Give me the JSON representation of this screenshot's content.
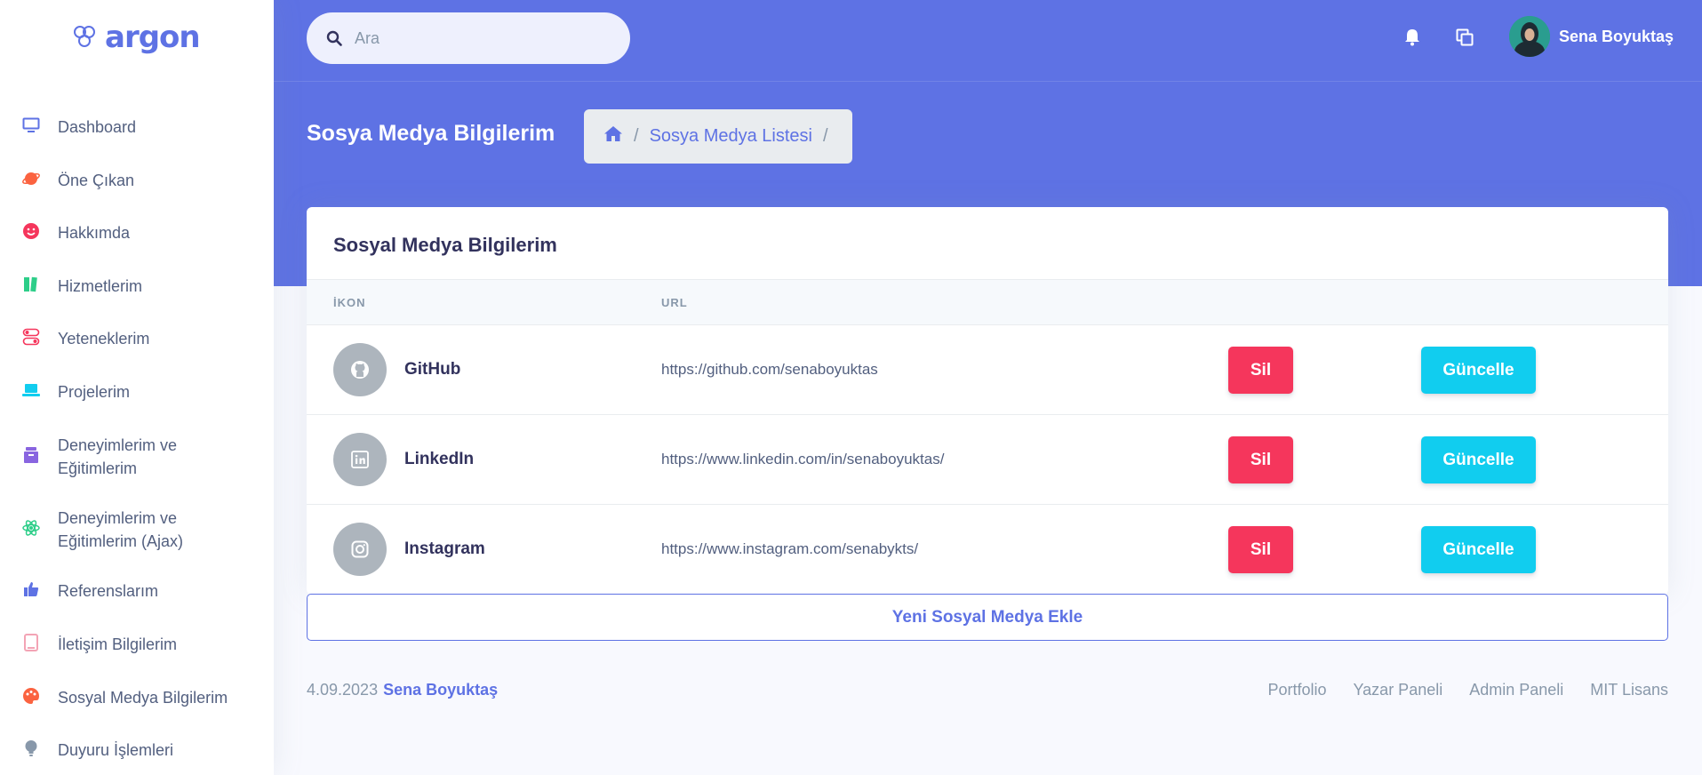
{
  "brand": {
    "name": "argon"
  },
  "sidebar": {
    "items": [
      {
        "label": "Dashboard",
        "icon": "monitor-icon",
        "color": "#5e72e4"
      },
      {
        "label": "Öne Çıkan",
        "icon": "planet-icon",
        "color": "#fb6340"
      },
      {
        "label": "Hakkımda",
        "icon": "smile-icon",
        "color": "#f5365c"
      },
      {
        "label": "Hizmetlerim",
        "icon": "books-icon",
        "color": "#2dce89"
      },
      {
        "label": "Yeteneklerim",
        "icon": "toggles-icon",
        "color": "#f5365c"
      },
      {
        "label": "Projelerim",
        "icon": "laptop-icon",
        "color": "#11cdef"
      },
      {
        "label": "Deneyimlerim ve Eğitimlerim",
        "icon": "archive-icon",
        "color": "#8965e0"
      },
      {
        "label": "Deneyimlerim ve Eğitimlerim (Ajax)",
        "icon": "atom-icon",
        "color": "#2dce89"
      },
      {
        "label": "Referenslarım",
        "icon": "thumbs-up-icon",
        "color": "#5e72e4"
      },
      {
        "label": "İletişim Bilgilerim",
        "icon": "tablet-icon",
        "color": "#f3a4b5"
      },
      {
        "label": "Sosyal Medya Bilgilerim",
        "icon": "palette-icon",
        "color": "#fb6340"
      },
      {
        "label": "Duyuru İşlemleri",
        "icon": "bulb-icon",
        "color": "#8898aa"
      }
    ]
  },
  "search": {
    "placeholder": "Ara"
  },
  "user": {
    "name": "Sena Boyuktaş"
  },
  "header": {
    "title": "Sosya Medya Bilgilerim",
    "breadcrumb": {
      "home_icon": "home-icon",
      "current": "Sosya Medya Listesi",
      "separator": "/"
    }
  },
  "card": {
    "title": "Sosyal Medya Bilgilerim",
    "columns": {
      "icon": "İKON",
      "url": "URL"
    },
    "rows": [
      {
        "name": "GitHub",
        "icon": "github-icon",
        "url": "https://github.com/senaboyuktas"
      },
      {
        "name": "LinkedIn",
        "icon": "linkedin-icon",
        "url": "https://www.linkedin.com/in/senaboyuktas/"
      },
      {
        "name": "Instagram",
        "icon": "instagram-icon",
        "url": "https://www.instagram.com/senabykts/"
      }
    ],
    "delete_label": "Sil",
    "update_label": "Güncelle",
    "add_label": "Yeni Sosyal Medya Ekle"
  },
  "footer": {
    "date": "4.09.2023",
    "author": "Sena Boyuktaş",
    "links": [
      "Portfolio",
      "Yazar Paneli",
      "Admin Paneli",
      "MIT Lisans"
    ]
  },
  "colors": {
    "primary": "#5e72e4",
    "danger": "#f5365c",
    "info": "#11cdef"
  }
}
